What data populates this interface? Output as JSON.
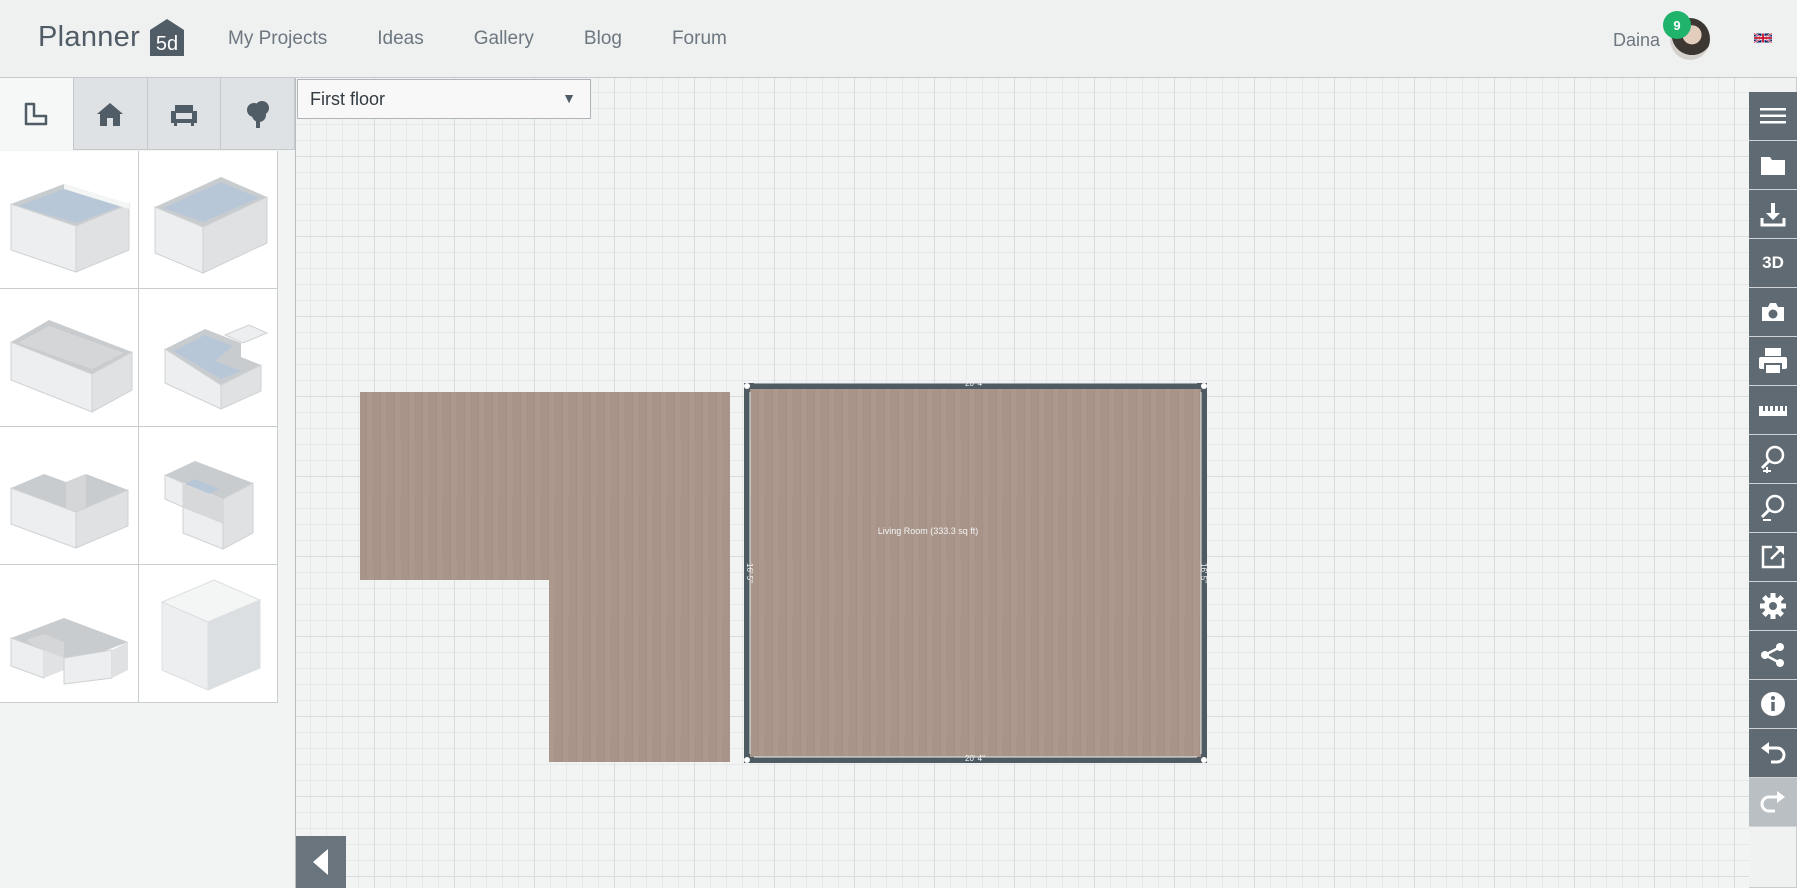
{
  "app": {
    "logo_text": "Planner",
    "logo_badge": "5d"
  },
  "nav": {
    "items": [
      {
        "label": "My Projects"
      },
      {
        "label": "Ideas"
      },
      {
        "label": "Gallery"
      },
      {
        "label": "Blog"
      },
      {
        "label": "Forum"
      }
    ]
  },
  "user": {
    "name": "Daina",
    "notifications": "9",
    "language_icon": "uk-flag-icon"
  },
  "catalog": {
    "tabs": [
      {
        "name": "construction",
        "icon": "wall-corner-icon"
      },
      {
        "name": "rooms",
        "icon": "house-icon"
      },
      {
        "name": "furniture",
        "icon": "armchair-icon"
      },
      {
        "name": "exterior",
        "icon": "tree-icon"
      }
    ],
    "active_tab": "rooms",
    "tiles": [
      {
        "shape": "rectangle-room"
      },
      {
        "shape": "square-room"
      },
      {
        "shape": "rectangle-room-wide"
      },
      {
        "shape": "l-notch-room"
      },
      {
        "shape": "l-shape-room"
      },
      {
        "shape": "corner-cut-room"
      },
      {
        "shape": "l-shape-room-low"
      },
      {
        "shape": "solid-block"
      }
    ]
  },
  "floor_selector": {
    "value": "First floor"
  },
  "plan": {
    "room_label": "Living Room (333.3 sq ft)",
    "dim_top": "20' 4\"",
    "dim_bottom": "20' 4\"",
    "dim_left": "16' 5\"",
    "dim_right": "16' 5\"",
    "floor_color": "#a89488",
    "wall_color": "#4f5b63"
  },
  "toolbar": {
    "tools": [
      {
        "name": "menu",
        "icon": "hamburger-icon"
      },
      {
        "name": "open",
        "icon": "folder-icon"
      },
      {
        "name": "save",
        "icon": "download-icon"
      },
      {
        "name": "view-3d",
        "label": "3D"
      },
      {
        "name": "snapshot",
        "icon": "camera-icon"
      },
      {
        "name": "print",
        "icon": "printer-icon"
      },
      {
        "name": "measure",
        "icon": "ruler-icon"
      },
      {
        "name": "zoom-in",
        "icon": "zoom-in-icon"
      },
      {
        "name": "zoom-out",
        "icon": "zoom-out-icon"
      },
      {
        "name": "export",
        "icon": "external-link-icon"
      },
      {
        "name": "settings",
        "icon": "gear-icon"
      },
      {
        "name": "share",
        "icon": "share-icon"
      },
      {
        "name": "info",
        "icon": "info-icon"
      },
      {
        "name": "undo",
        "icon": "undo-icon"
      },
      {
        "name": "redo",
        "icon": "redo-icon",
        "disabled": true
      }
    ]
  },
  "colors": {
    "toolbar": "#5f6a72",
    "notification": "#1fb36b",
    "accent_text": "#6d7780"
  }
}
